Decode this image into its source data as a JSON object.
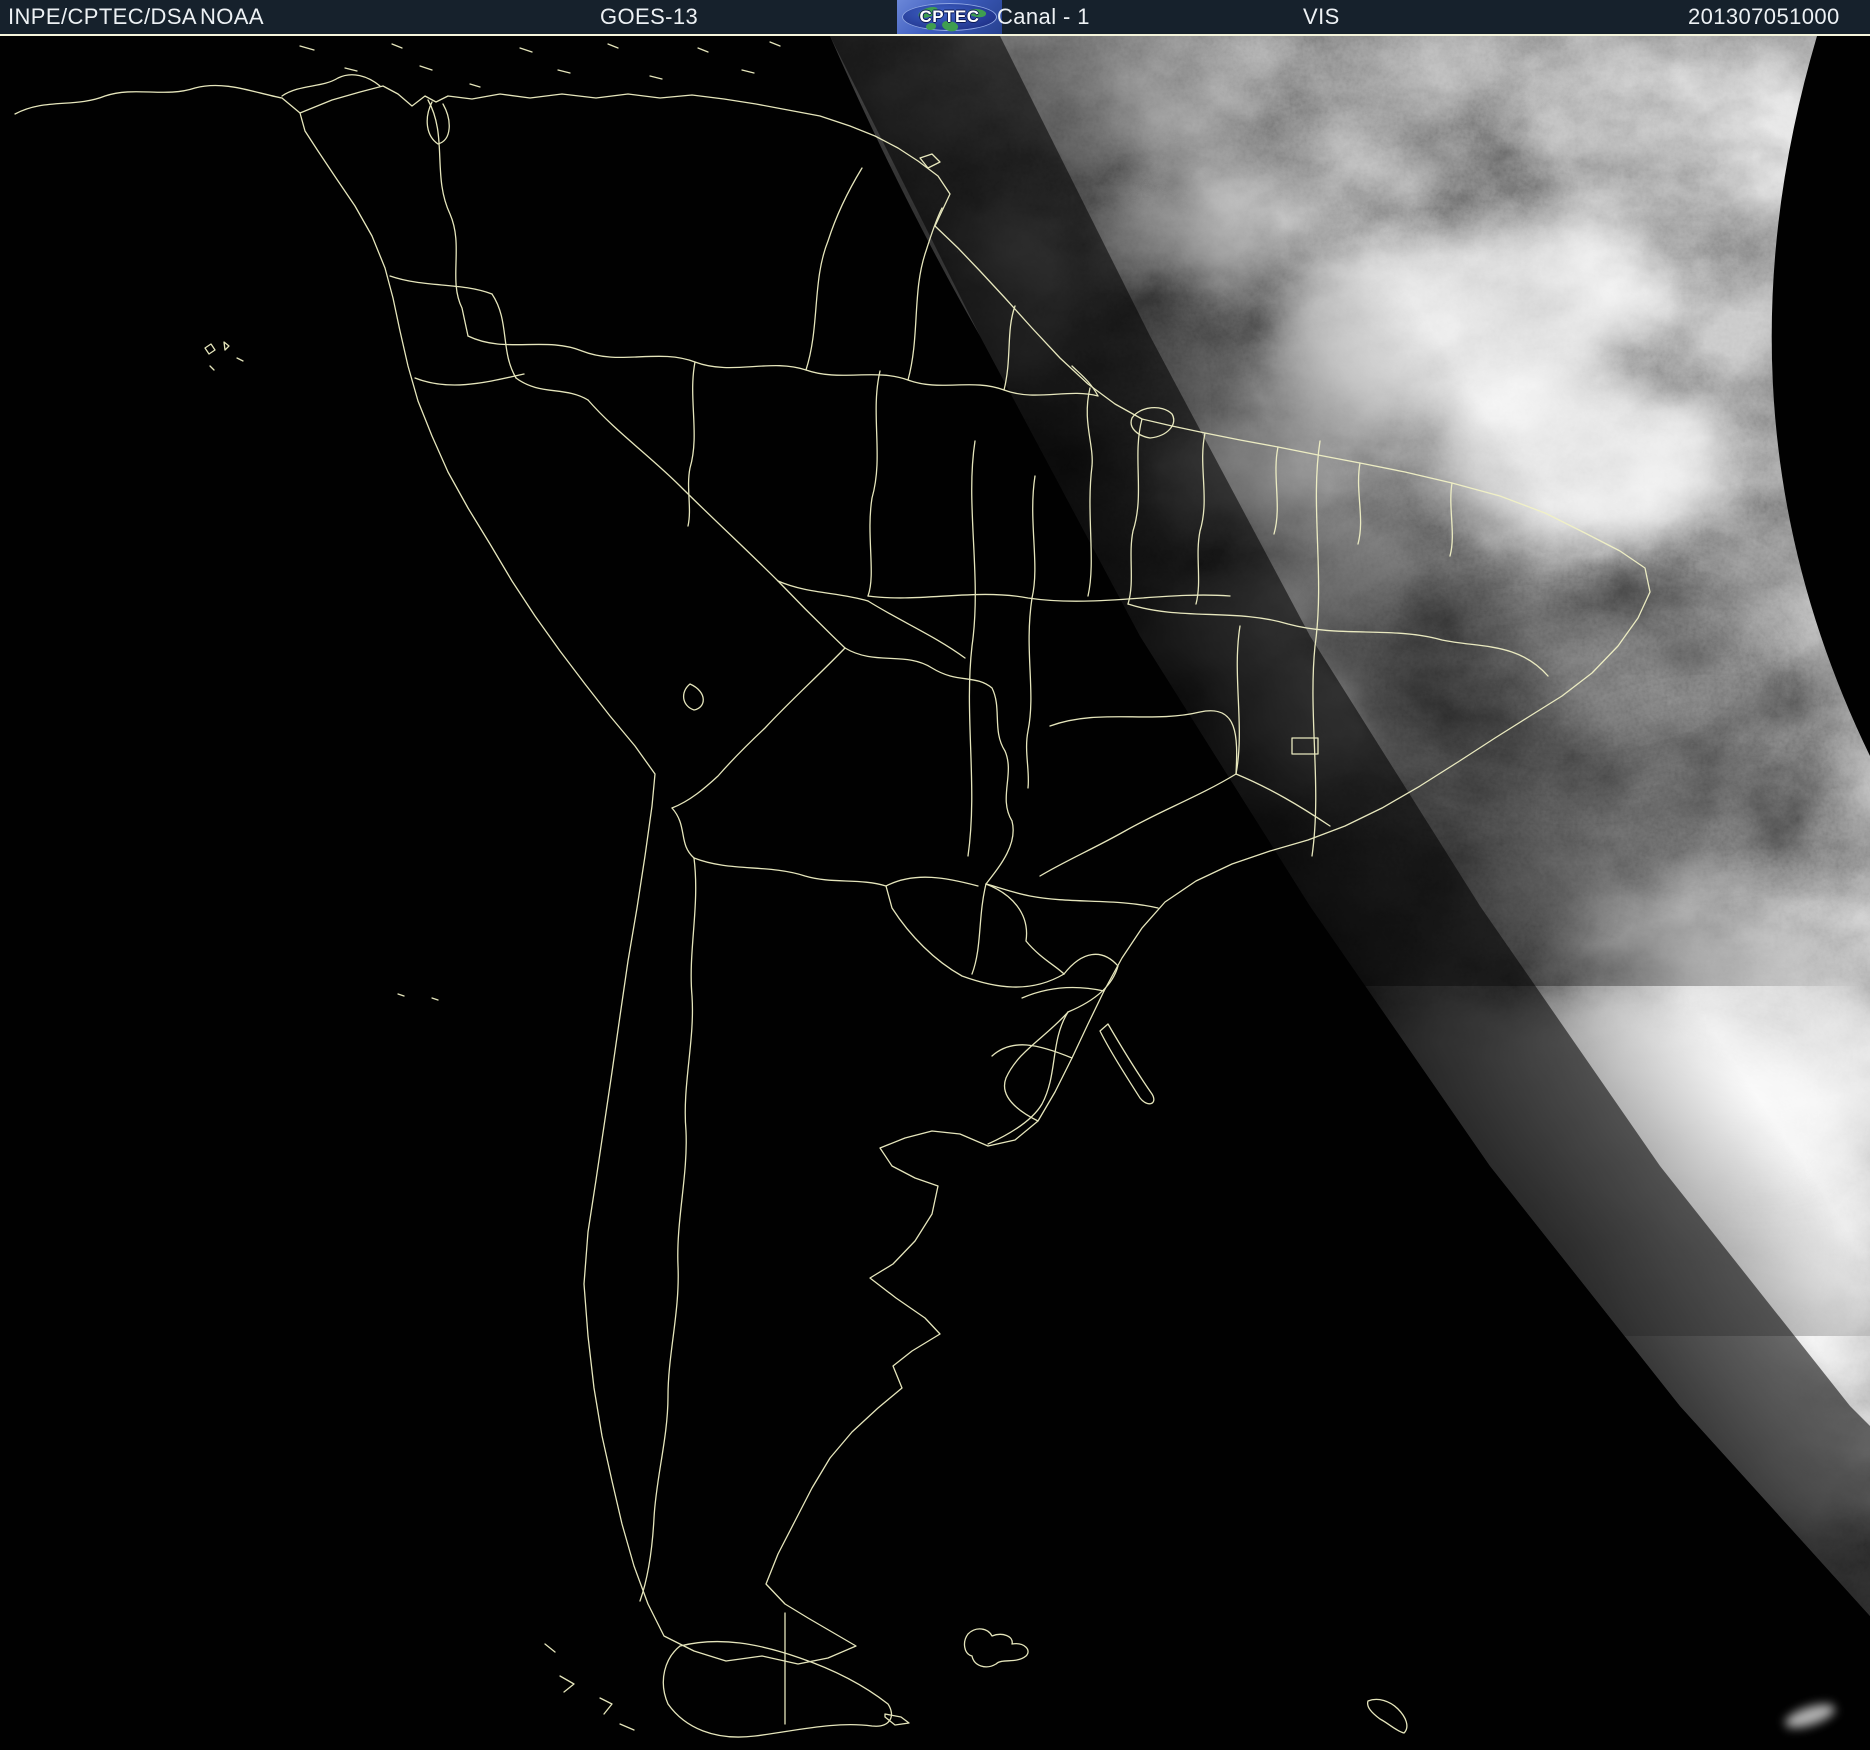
{
  "header": {
    "agency": "INPE/CPTEC/DSA",
    "noaa": "NOAA",
    "satellite": "GOES-13",
    "channel": "Canal - 1",
    "channel_type": "VIS",
    "timestamp": "201307051000",
    "bg_color": "#16212c",
    "text_color": "#edf1f4",
    "separator_color": "#f5f5dc"
  },
  "logo": {
    "text": "CPTEC",
    "bg_color": "#3d5cbe",
    "globe_color": "#22368f",
    "land_color": "#3f9e4f"
  },
  "map": {
    "border_color": "#f2f2c6",
    "night_color": "#000000",
    "day_base_color": "#6f6f6f",
    "space_color": "#000000"
  }
}
